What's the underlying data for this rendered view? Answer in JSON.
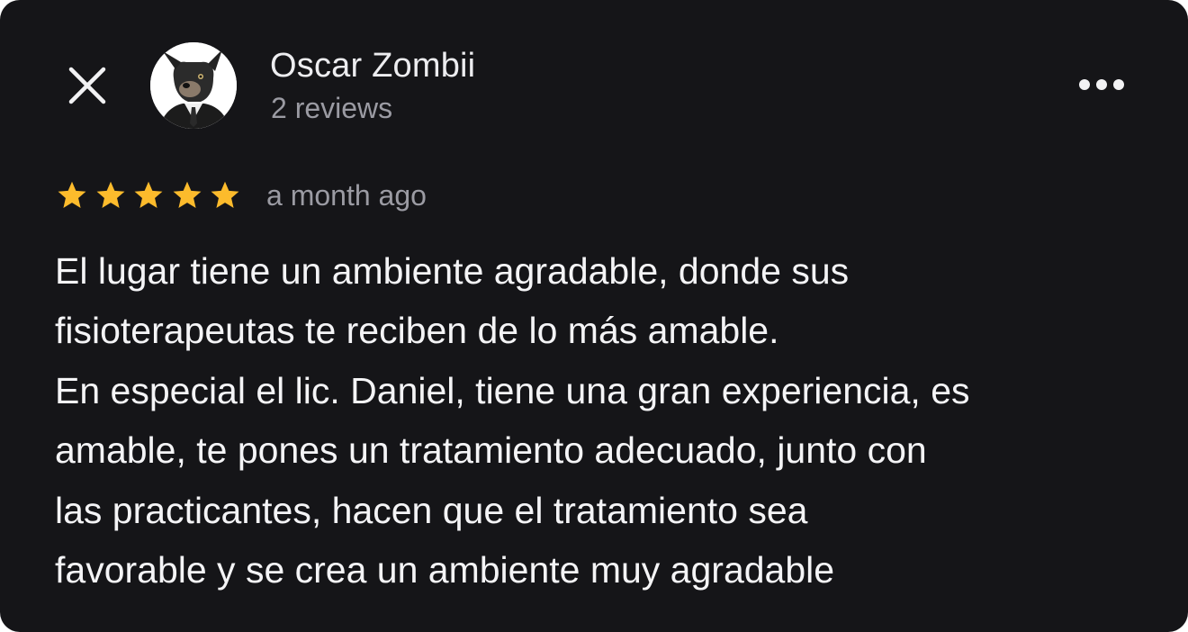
{
  "header": {
    "close_icon": "close-icon",
    "avatar_icon": "avatar-dog-in-suit",
    "user_name": "Oscar Zombii",
    "review_count": "2 reviews",
    "more_icon": "more-horizontal-icon"
  },
  "review": {
    "rating": 5,
    "max_rating": 5,
    "star_color": "#fcbb2c",
    "time_ago": "a month ago",
    "lines": [
      "El lugar tiene un ambiente agradable, donde sus",
      "fisioterapeutas te reciben de lo más amable.",
      "En especial el lic. Daniel, tiene una gran experiencia, es",
      "amable, te pones un tratamiento adecuado, junto con",
      "las practicantes, hacen que el tratamiento sea",
      "favorable y se crea un ambiente muy agradable"
    ]
  },
  "colors": {
    "background": "#151518",
    "primary_text": "#f4f4f6",
    "secondary_text": "#9b9ba3"
  }
}
